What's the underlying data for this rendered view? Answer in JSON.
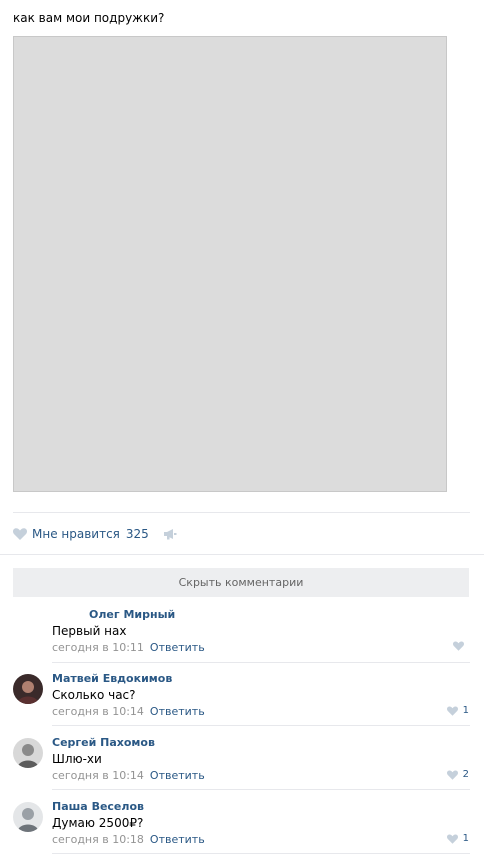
{
  "post": {
    "text": "как вам мои подружки?"
  },
  "actions": {
    "like_label": "Мне нравится",
    "like_count": "325"
  },
  "comments_toggle": "Скрыть комментарии",
  "comments": [
    {
      "author": "Олег Мирный",
      "text": "Первый нах",
      "time": "сегодня в 10:11",
      "reply": "Ответить",
      "likes": ""
    },
    {
      "author": "Матвей Евдокимов",
      "text": "Сколько час?",
      "time": "сегодня в 10:14",
      "reply": "Ответить",
      "likes": "1"
    },
    {
      "author": "Сергей Пахомов",
      "text": "Шлю-хи",
      "time": "сегодня в 10:14",
      "reply": "Ответить",
      "likes": "2"
    },
    {
      "author": "Паша Веселов",
      "text": "Думаю 2500₽?",
      "time": "сегодня в 10:18",
      "reply": "Ответить",
      "likes": "1"
    }
  ],
  "colors": {
    "link": "#2a5885",
    "muted": "#939393",
    "like_icon": "#c5d0db",
    "toggle_bg": "#edeef0"
  }
}
